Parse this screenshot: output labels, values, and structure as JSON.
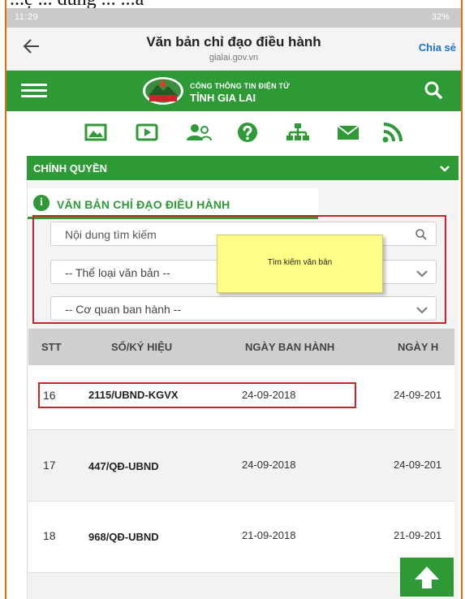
{
  "doc_caption": "...ệ  ... dung  ... ...a",
  "status_bar": {
    "time": "11:29",
    "battery": "32%"
  },
  "title_bar": {
    "title": "Văn bản chỉ đạo điều hành",
    "domain": "gialai.gov.vn",
    "share": "Chia sẻ"
  },
  "portal": {
    "line1": "CỔNG THÔNG TIN ĐIỆN TỬ",
    "line2": "TỈNH GIA LAI",
    "logo_text": "GIA LAI"
  },
  "icons": [
    "image-icon",
    "video-icon",
    "people-icon",
    "help-icon",
    "sitemap-icon",
    "mail-icon",
    "rss-icon"
  ],
  "category": {
    "label": "CHÍNH QUYỀN"
  },
  "panel": {
    "tab_label": "VĂN BẢN CHỈ ĐẠO ĐIỀU HÀNH"
  },
  "search": {
    "keyword_placeholder": "Nội dung tìm kiếm",
    "doc_type": "-- Thể loại văn bản --",
    "agency": "-- Cơ quan ban hành --"
  },
  "tooltip": "Tìm kiếm văn bản",
  "table": {
    "headers": [
      "STT",
      "SỐ/KÝ HIỆU",
      "NGÀY BAN HÀNH",
      "NGÀY H"
    ],
    "rows": [
      {
        "stt": "16",
        "code": "2115/UBND-KGVX",
        "issued": "24-09-2018",
        "effective": "24-09-201"
      },
      {
        "stt": "17",
        "code": "447/QĐ-UBND",
        "issued": "24-09-2018",
        "effective": "24-09-201"
      },
      {
        "stt": "18",
        "code": "968/QĐ-UBND",
        "issued": "21-09-2018",
        "effective": "21-09-201"
      }
    ]
  },
  "colors": {
    "green": "#2e9a36",
    "highlight_red": "#c9242b",
    "share_blue": "#1a73c9",
    "tooltip_yellow": "#ffff88"
  }
}
